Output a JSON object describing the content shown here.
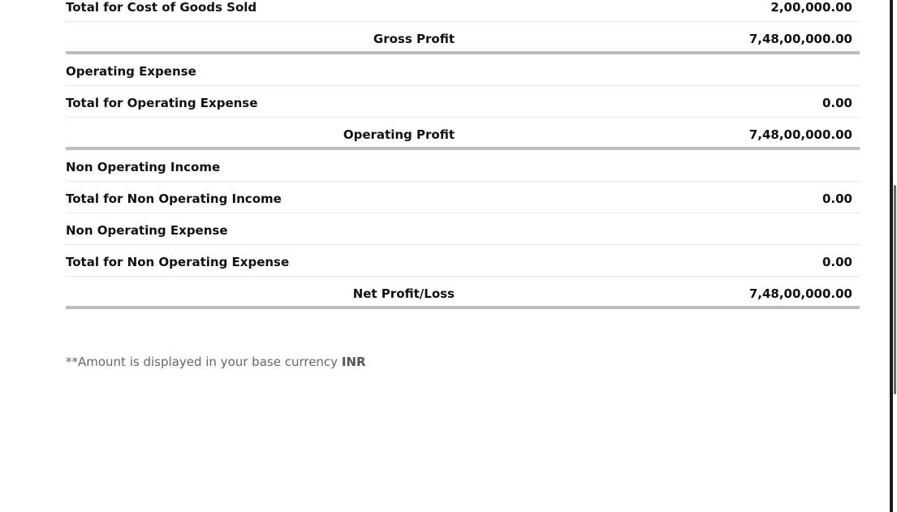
{
  "rows": [
    {
      "label": "Total for Cost of Goods Sold",
      "center": "",
      "amount": "2,00,000.00"
    },
    {
      "label": "",
      "center": "Gross Profit",
      "amount": "7,48,00,000.00"
    },
    {
      "label": "Operating Expense",
      "center": "",
      "amount": ""
    },
    {
      "label": "Total for Operating Expense",
      "center": "",
      "amount": "0.00"
    },
    {
      "label": "",
      "center": "Operating Profit",
      "amount": "7,48,00,000.00"
    },
    {
      "label": "Non Operating Income",
      "center": "",
      "amount": ""
    },
    {
      "label": "Total for Non Operating Income",
      "center": "",
      "amount": "0.00"
    },
    {
      "label": "Non Operating Expense",
      "center": "",
      "amount": ""
    },
    {
      "label": "Total for Non Operating Expense",
      "center": "",
      "amount": "0.00"
    },
    {
      "label": "",
      "center": "Net Profit/Loss",
      "amount": "7,48,00,000.00"
    }
  ],
  "footnote": {
    "text": "**Amount is displayed in your base currency ",
    "currency": "INR"
  }
}
